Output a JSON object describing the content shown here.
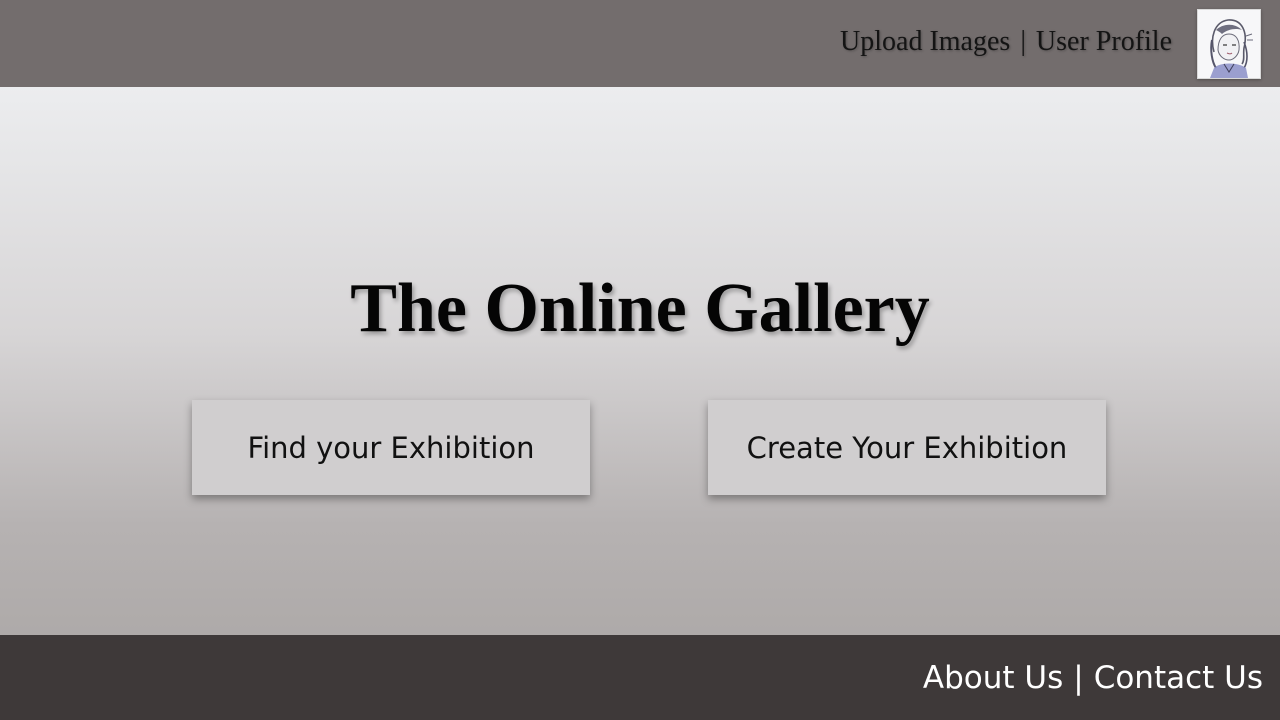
{
  "header": {
    "nav": [
      {
        "label": "Upload Images"
      },
      {
        "label": "User Profile"
      }
    ],
    "separator": "|",
    "avatar_icon": "user-avatar-sketch"
  },
  "main": {
    "title": "The Online Gallery",
    "buttons": [
      {
        "label": "Find your Exhibition"
      },
      {
        "label": "Create Your Exhibition"
      }
    ]
  },
  "footer": {
    "nav": [
      {
        "label": "About Us"
      },
      {
        "label": "Contact Us"
      }
    ],
    "separator": "|"
  },
  "colors": {
    "header_bg": "#736d6d",
    "footer_bg": "#3e3939",
    "button_bg": "#d0cecf"
  }
}
